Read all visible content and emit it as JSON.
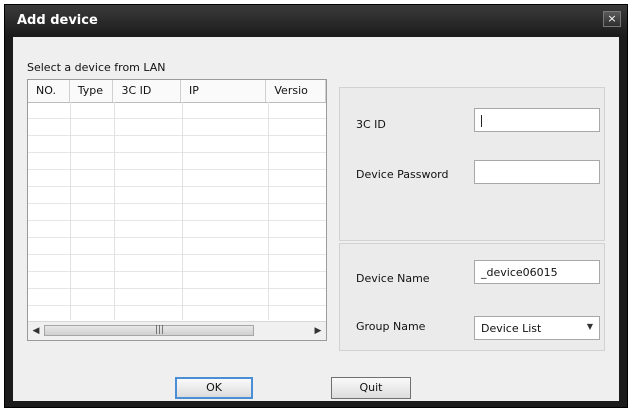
{
  "window": {
    "title": "Add device",
    "close_label": "×"
  },
  "device_list": {
    "label": "Select a device from LAN",
    "columns": [
      "NO.",
      "Type",
      "3C ID",
      "IP",
      "Versio"
    ],
    "rows": [],
    "scroll_left": "◀",
    "scroll_right": "▶",
    "scroll_grip": "|||"
  },
  "login_group": {
    "id_label": "3C ID",
    "id_value": "",
    "password_label": "Device Password",
    "password_value": ""
  },
  "name_group": {
    "name_label": "Device Name",
    "name_value": "_device06015",
    "group_label": "Group Name",
    "group_value": "Device List",
    "dropdown_arrow": "▼"
  },
  "buttons": {
    "ok": "OK",
    "quit": "Quit"
  },
  "colors": {
    "frame": "#1c1c1c",
    "client": "#efefef",
    "default_button_border": "#4a8fd6"
  }
}
